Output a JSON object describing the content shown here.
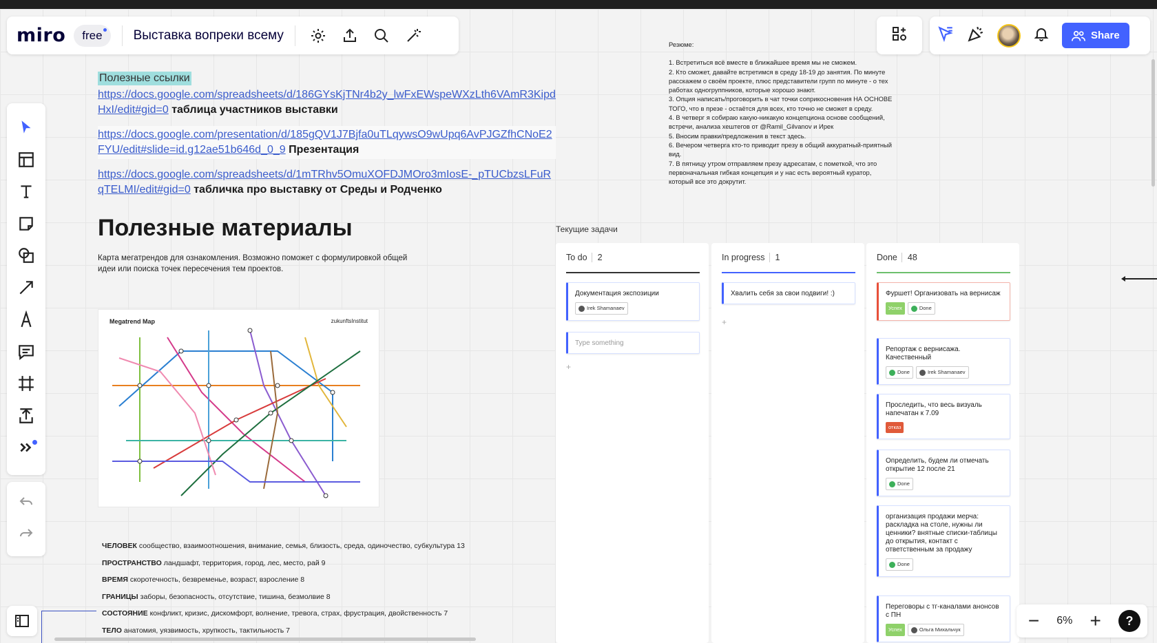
{
  "app": {
    "logo": "miro",
    "plan": "free",
    "board_title": "Выставка вопреки всему",
    "share_label": "Share"
  },
  "colors": {
    "accent": "#4262ff",
    "highlight": "#9fdede",
    "done_line": "#6dbf6d",
    "todo_line": "#333333",
    "progress_line": "#4262ff"
  },
  "icons": {
    "top": [
      "settings-icon",
      "upload-icon",
      "search-icon",
      "magic-icon"
    ],
    "top_right": [
      "apps-icon",
      "reactions-icon",
      "celebrate-icon",
      "bell-icon",
      "share-people-icon"
    ],
    "tools": [
      "select-icon",
      "templates-icon",
      "text-icon",
      "sticky-note-icon",
      "shapes-icon",
      "line-icon",
      "pen-icon",
      "comment-icon",
      "frame-icon",
      "upload-icon",
      "more-tools-icon"
    ]
  },
  "links": {
    "title": "Полезные ссылки",
    "items": [
      {
        "url": "https://docs.google.com/spreadsheets/d/186GYsKjTNr4b2y_lwFxEWspeWXzLth6VAmR3KipdHxI/edit#gid=0",
        "label": "таблица участников выставки"
      },
      {
        "url": "https://docs.google.com/presentation/d/185gQV1J7Bjfa0uTLqywsO9wUpq6AvPJGZfhCNoE2FYU/edit#slide=id.g12ae51b646d_0_9",
        "label": "Презентация"
      },
      {
        "url": "https://docs.google.com/spreadsheets/d/1mTRhv5OmuXOFDJMOro3mIosE-_pTUCbzsLFuRqTELMI/edit#gid=0",
        "label": "табличка про выставку от Среды и Родченко"
      }
    ]
  },
  "resume": {
    "title": "Резюме:",
    "lines": [
      "1. Встретиться всё вместе в ближайшее время мы не сможем.",
      "2. Кто сможет, давайте встретимся в среду 18-19 до занятия. По минуте расскажем о своём проекте, плюс представители групп по минуте - о тех работах одногруппников, которые хорошо знают.",
      "3. Опция написать/проговорить в чат точки соприкосновения НА ОСНОВЕ ТОГО, что в презе - остаётся для всех, кто точно не сможет в среду.",
      "4. В четверг я собираю какую-никакую концепциона основе сообщений, встречи, анализа хештегов от @Ramil_Gilvanov и Ирек",
      "5. Вносим правки/предложения в текст здесь.",
      "6. Вечером четверга кто-то приводит презу в общий аккуратный-приятный вид.",
      "7. В пятницу утром отправляем презу адресатам, с пометкой, что это первоначальная гибкая концепция и у нас есть вероятный куратор, который все это докрутит."
    ]
  },
  "materials": {
    "heading": "Полезные материалы",
    "description": "Карта мегатрендов для ознакомления. Возможно поможет с формулировкой общей идеи или поиска точек пересечения тем проектов.",
    "map_title": "Megatrend Map",
    "map_brand": "zukunftsInstitut"
  },
  "themes": [
    {
      "name": "ЧЕЛОВЕК",
      "text": "сообщество, взаимоотношения, внимание, семья, близость, среда, одиночество, субкультура 13"
    },
    {
      "name": "ПРОСТРАНСТВО",
      "text": "ландшафт, территория, город, лес, место, рай 9"
    },
    {
      "name": "ВРЕМЯ",
      "text": "скоротечность, безвременье, возраст, взросление 8"
    },
    {
      "name": "ГРАНИЦЫ",
      "text": "заборы, безопасность, отсутствие, тишина, безмолвие 8"
    },
    {
      "name": "СОСТОЯНИЕ",
      "text": "конфликт, кризис, дискомфорт, волнение, тревога, страх, фрустрация, двойственность 7"
    },
    {
      "name": "ТЕЛО",
      "text": "анатомия, уязвимость, хрупкость, тактильность 7"
    }
  ],
  "kanban": {
    "title": "Текущие задачи",
    "columns": [
      {
        "name": "To do",
        "count": "2",
        "cards": [
          {
            "text": "Документация экспозиции",
            "tags": [
              {
                "type": "user",
                "label": "Irek Shamanaev"
              }
            ]
          },
          {
            "text": "Type something",
            "placeholder": true,
            "tags": []
          }
        ]
      },
      {
        "name": "In progress",
        "count": "1",
        "cards": [
          {
            "text": "Хвалить себя за свои подвиги! :)",
            "tags": []
          }
        ]
      },
      {
        "name": "Done",
        "count": "48",
        "cards": [
          {
            "text": "Фуршет! Организовать на вернисаж",
            "red": true,
            "tags": [
              {
                "type": "green",
                "label": "Успех"
              },
              {
                "type": "done",
                "label": "Done"
              }
            ]
          },
          {
            "text": "Репортаж с вернисажа. Качественный",
            "tags": [
              {
                "type": "done",
                "label": "Done"
              },
              {
                "type": "user",
                "label": "Irek Shamanaev"
              }
            ]
          },
          {
            "text": "Проследить, что весь визуаль напечатан к 7.09",
            "tags": [
              {
                "type": "red",
                "label": "отказ"
              }
            ]
          },
          {
            "text": "Определить, будем ли отмечать открытие 12 после 21",
            "tags": [
              {
                "type": "done",
                "label": "Done"
              }
            ]
          },
          {
            "text": "организация продажи мерча: раскладка на столе, нужны ли ценники? внятные списки-таблицы до открытия, контакт с ответственным за продажу",
            "tags": [
              {
                "type": "done",
                "label": "Done"
              }
            ]
          },
          {
            "text": "Переговоры с тг-каналами анонсов с ПН",
            "tags": [
              {
                "type": "green",
                "label": "Успех"
              },
              {
                "type": "user",
                "label": "Ольга Михальчук"
              }
            ]
          }
        ]
      }
    ]
  },
  "zoom": {
    "value": "6%",
    "minus": "−",
    "plus": "+",
    "help": "?"
  }
}
